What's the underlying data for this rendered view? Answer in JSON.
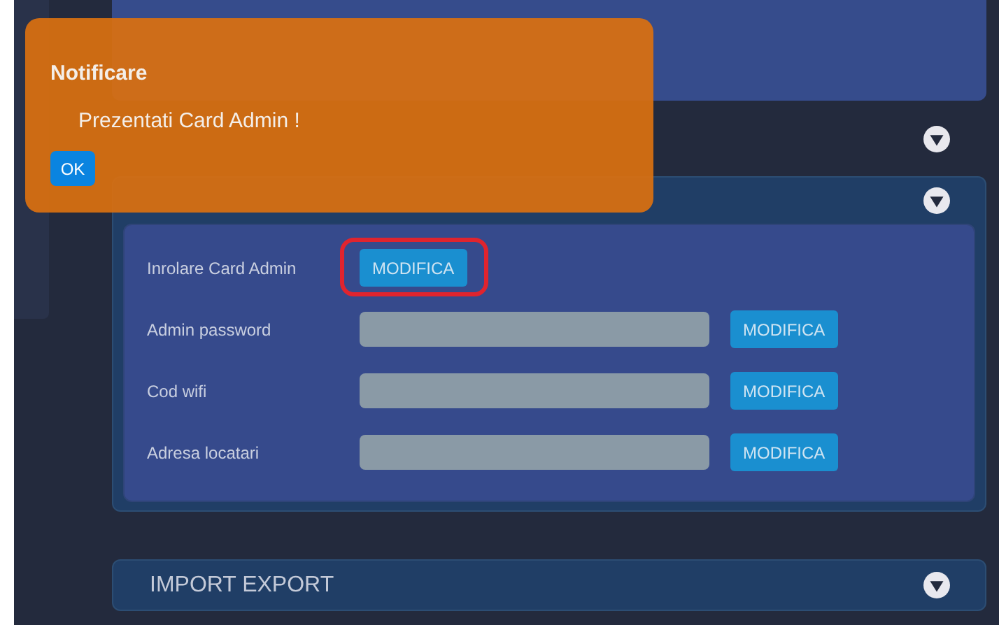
{
  "notification": {
    "title": "Notificare",
    "message": "Prezentati Card Admin !",
    "button": "OK"
  },
  "settings": {
    "rows": [
      {
        "label": "Inrolare Card Admin",
        "kind": "button",
        "button": "MODIFICA",
        "highlighted": true
      },
      {
        "label": "Admin password",
        "kind": "field",
        "button": "MODIFICA",
        "highlighted": false
      },
      {
        "label": "Cod wifi",
        "kind": "field",
        "button": "MODIFICA",
        "highlighted": false
      },
      {
        "label": "Adresa locatari",
        "kind": "field",
        "button": "MODIFICA",
        "highlighted": false
      }
    ]
  },
  "import_export": {
    "title": "IMPORT EXPORT"
  }
}
